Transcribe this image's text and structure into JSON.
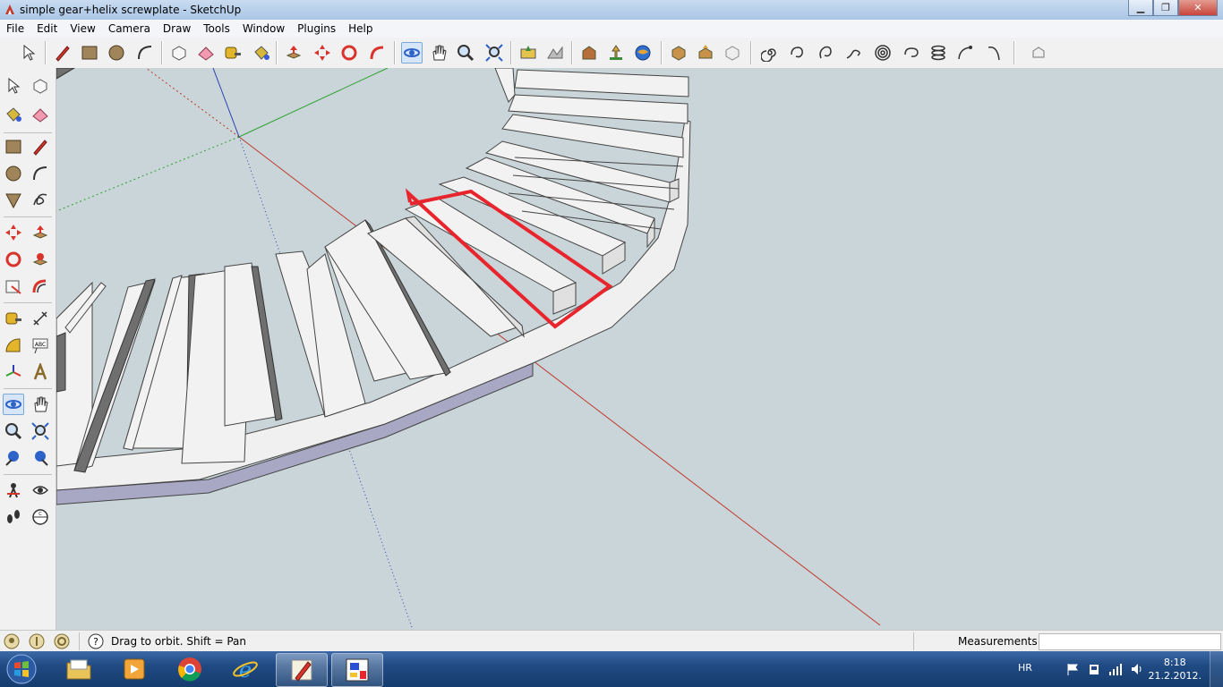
{
  "window": {
    "title": "simple gear+helix screwplate - SketchUp",
    "minimize": "▁",
    "restore": "❐",
    "close": "✕"
  },
  "menu": [
    "File",
    "Edit",
    "View",
    "Camera",
    "Draw",
    "Tools",
    "Window",
    "Plugins",
    "Help"
  ],
  "status": {
    "hint": "Drag to orbit.  Shift = Pan",
    "measurements_label": "Measurements",
    "measurements_value": ""
  },
  "taskbar": {
    "language": "HR",
    "time": "8:18",
    "date": "21.2.2012."
  },
  "colors": {
    "viewport_bg": "#c9d5d9",
    "step_face": "#f2f2f2",
    "step_shadow": "#6f6f6f",
    "stringer": "#a8a8c4",
    "axis_red": "#c0392b",
    "axis_green": "#2fa12f",
    "axis_blue": "#2a3fb0",
    "highlight": "#e8242c"
  }
}
